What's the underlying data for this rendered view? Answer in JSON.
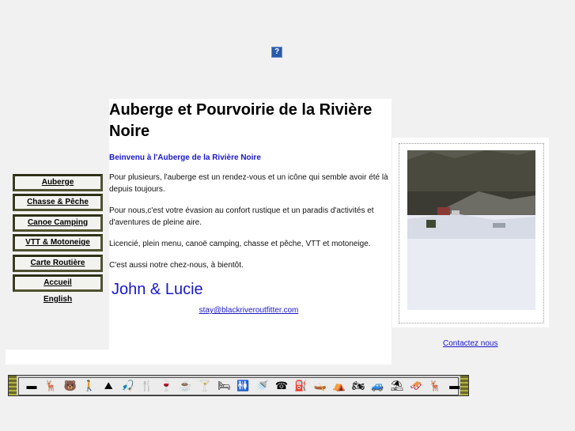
{
  "broken_image_glyph": "?",
  "header": {
    "title": "Auberge et Pourvoirie de la Rivière Noire"
  },
  "nav": {
    "items": [
      {
        "label": "Auberge"
      },
      {
        "label": "Chasse & Pêche"
      },
      {
        "label": "Canoe Camping"
      },
      {
        "label": "VTT & Motoneige"
      },
      {
        "label": "Carte Routière"
      },
      {
        "label": "Accueil"
      }
    ],
    "english": "English"
  },
  "main": {
    "welcome": "Beinvenu à l'Auberge de la Rivière Noire",
    "paragraphs": [
      "Pour plusieurs, l'auberge est un rendez-vous et un icône qui semble avoir été là depuis toujours.",
      "Pour nous,c'est votre évasion au confort rustique et un paradis d'activités et d'aventures de pleine aire.",
      "Licencié, plein menu, canoë camping, chasse et pêche, VTT et motoneige.",
      "C'est aussi notre chez-nous, à bientôt."
    ],
    "signature": "John & Lucie",
    "email": "stay@blackriveroutfitter.com"
  },
  "photo": {
    "contact_label": "Contactez nous"
  },
  "iconbar": {
    "icons": [
      {
        "name": "dash-icon",
        "glyph": "▬"
      },
      {
        "name": "moose-icon",
        "glyph": "🦌"
      },
      {
        "name": "bear-icon",
        "glyph": "🐻"
      },
      {
        "name": "hiker-icon",
        "glyph": "🚶"
      },
      {
        "name": "landscape-icon",
        "glyph": "⛰"
      },
      {
        "name": "fishing-icon",
        "glyph": "🎣"
      },
      {
        "name": "utensils-icon",
        "glyph": "🍴"
      },
      {
        "name": "wine-icon",
        "glyph": "🍷"
      },
      {
        "name": "coffee-icon",
        "glyph": "☕"
      },
      {
        "name": "cocktail-icon",
        "glyph": "🍸"
      },
      {
        "name": "bed-icon",
        "glyph": "🛏"
      },
      {
        "name": "restroom-icon",
        "glyph": "🚻"
      },
      {
        "name": "shower-icon",
        "glyph": "🚿"
      },
      {
        "name": "phone-icon",
        "glyph": "☎"
      },
      {
        "name": "fuel-icon",
        "glyph": "⛽"
      },
      {
        "name": "canoe-icon",
        "glyph": "🛶"
      },
      {
        "name": "tent-icon",
        "glyph": "⛺"
      },
      {
        "name": "atv-icon",
        "glyph": "🏍"
      },
      {
        "name": "truck-icon",
        "glyph": "🚙"
      },
      {
        "name": "picnic-icon",
        "glyph": "⛱"
      },
      {
        "name": "snowmobile-icon",
        "glyph": "🛷"
      },
      {
        "name": "deer-icon",
        "glyph": "🦌"
      },
      {
        "name": "dash-end-icon",
        "glyph": "▬"
      }
    ]
  }
}
